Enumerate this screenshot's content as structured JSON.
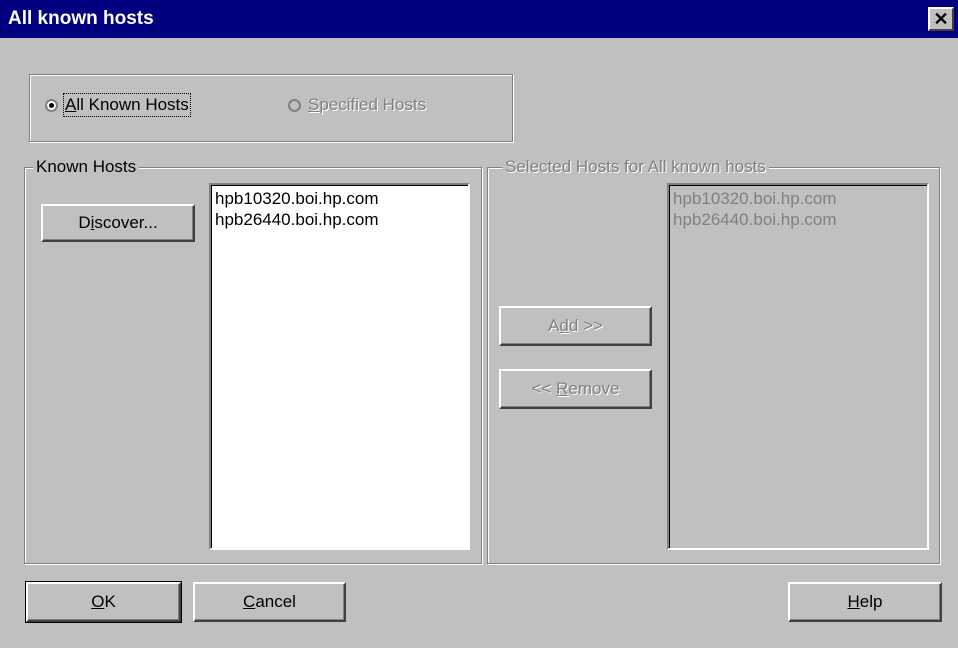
{
  "window": {
    "title": "All known hosts",
    "close_glyph": "✕"
  },
  "scope": {
    "options": [
      {
        "label": "All Known Hosts",
        "accel": "A",
        "rest": "ll Known Hosts",
        "selected": true,
        "enabled": true
      },
      {
        "label": "Specified Hosts",
        "accel": "S",
        "rest": "pecified Hosts",
        "selected": false,
        "enabled": false
      }
    ]
  },
  "known_hosts": {
    "group_label": "Known Hosts",
    "discover_button": {
      "label": "Discover...",
      "pre": "D",
      "accel": "i",
      "rest": "scover..."
    },
    "items": [
      "hpb10320.boi.hp.com",
      "hpb26440.boi.hp.com"
    ]
  },
  "selected_hosts": {
    "group_label": "Selected Hosts for All known hosts",
    "items": [
      "hpb10320.boi.hp.com",
      "hpb26440.boi.hp.com"
    ]
  },
  "transfer": {
    "add": {
      "label": "Add >>",
      "pre": "A",
      "accel": "d",
      "rest": "d >>"
    },
    "remove": {
      "label": "<< Remove",
      "pre": "<< ",
      "accel": "R",
      "rest": "emove"
    }
  },
  "footer": {
    "ok": {
      "label": "OK",
      "accel": "O",
      "rest": "K"
    },
    "cancel": {
      "label": "Cancel",
      "accel": "C",
      "rest": "ancel"
    },
    "help": {
      "label": "Help",
      "accel": "H",
      "rest": "elp"
    }
  },
  "colors": {
    "titlebar": "#000080",
    "face": "#c0c0c0",
    "disabled_text": "#808080"
  }
}
